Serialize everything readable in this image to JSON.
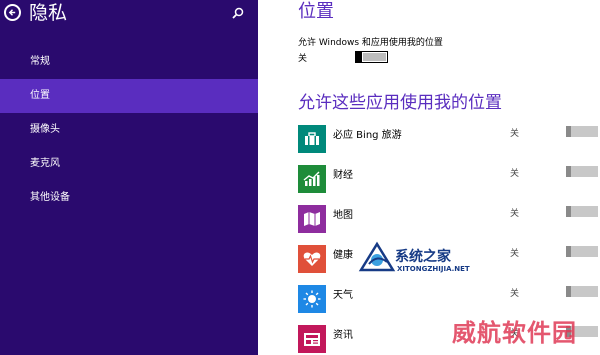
{
  "sidebar": {
    "title": "隐私",
    "items": [
      {
        "label": "常规",
        "active": false
      },
      {
        "label": "位置",
        "active": true
      },
      {
        "label": "摄像头",
        "active": false
      },
      {
        "label": "麦克风",
        "active": false
      },
      {
        "label": "其他设备",
        "active": false
      }
    ]
  },
  "main": {
    "page_title": "位置",
    "allow_label": "允许 Windows 和应用使用我的位置",
    "allow_state": "关",
    "section_title": "允许这些应用使用我的位置",
    "apps": [
      {
        "name": "必应 Bing 旅游",
        "state": "关",
        "icon": "briefcase-icon",
        "color": "#00897b"
      },
      {
        "name": "财经",
        "state": "关",
        "icon": "chart-icon",
        "color": "#1e8c3a"
      },
      {
        "name": "地图",
        "state": "关",
        "icon": "map-icon",
        "color": "#8e2d9e"
      },
      {
        "name": "健康",
        "state": "关",
        "icon": "heart-icon",
        "color": "#e0503a"
      },
      {
        "name": "天气",
        "state": "关",
        "icon": "sun-icon",
        "color": "#1e88e5"
      },
      {
        "name": "资讯",
        "state": "关",
        "icon": "news-icon",
        "color": "#c2185b"
      }
    ]
  },
  "watermarks": {
    "site_name": "系统之家",
    "site_url": "XITONGZHIJIA.NET",
    "park_name": "威航软件园"
  },
  "colors": {
    "sidebar_bg": "#2a0a6e",
    "active_bg": "#5a2dbf",
    "accent": "#5a2dbf"
  }
}
